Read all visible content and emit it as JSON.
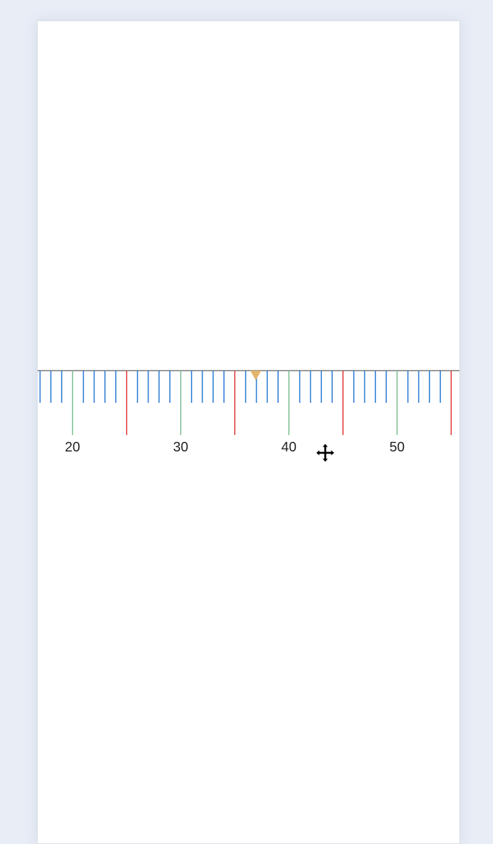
{
  "ruler": {
    "min": 17,
    "max": 55,
    "minor_step": 1,
    "major_step": 10,
    "mid_step": 5,
    "labels": [
      "20",
      "30",
      "40",
      "50"
    ],
    "current_value": 37,
    "colors": {
      "background": "#e8edf6",
      "card": "#ffffff",
      "baseline": "#777777",
      "minor_tick": "#2a7bd4",
      "mid_tick": "#e23c3c",
      "major_tick": "#7fbf95",
      "indicator": "#e3b56a",
      "label": "#222222"
    },
    "cursor_icon": "move-cursor-icon"
  }
}
